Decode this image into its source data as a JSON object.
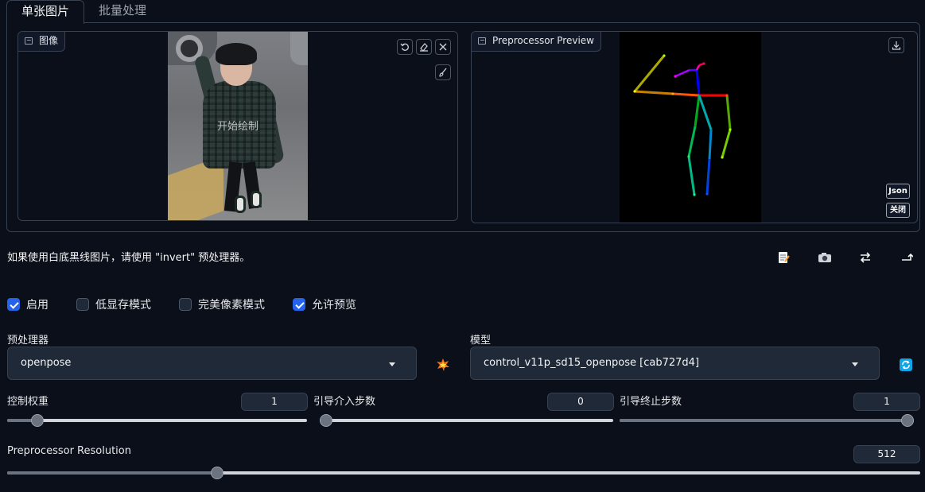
{
  "tabs": [
    {
      "label": "单张图片",
      "active": true
    },
    {
      "label": "批量处理",
      "active": false
    }
  ],
  "image_panel": {
    "label": "图像",
    "draw_hint": "开始绘制",
    "icons": [
      "undo-icon",
      "eraser-icon",
      "close-icon",
      "brush-icon"
    ]
  },
  "preview_panel": {
    "label": "Preprocessor Preview",
    "json_button": "Json",
    "close_button": "关闭",
    "icons": [
      "download-icon"
    ]
  },
  "hint": "如果使用白底黑线图片，请使用 \"invert\" 预处理器。",
  "toolbar_icons": [
    "memo-icon",
    "camera-icon",
    "swap-icon",
    "send-icon"
  ],
  "checkboxes": [
    {
      "label": "启用",
      "checked": true
    },
    {
      "label": "低显存模式",
      "checked": false
    },
    {
      "label": "完美像素模式",
      "checked": false
    },
    {
      "label": "允许预览",
      "checked": true
    }
  ],
  "preprocessor": {
    "label": "预处理器",
    "value": "openpose",
    "run_icon": "explosion-icon"
  },
  "model": {
    "label": "模型",
    "value": "control_v11p_sd15_openpose [cab727d4]",
    "refresh_icon": "refresh-icon"
  },
  "sliders": {
    "weight": {
      "label": "控制权重",
      "value": "1",
      "fraction": 0.1
    },
    "start": {
      "label": "引导介入步数",
      "value": "0",
      "fraction": 0.0
    },
    "end": {
      "label": "引导终止步数",
      "value": "1",
      "fraction": 1.0
    },
    "resolution": {
      "label": "Preprocessor Resolution",
      "value": "512",
      "fraction": 0.23
    }
  },
  "colors": {
    "background": "#0b0f19",
    "accent": "#2563eb",
    "panel_border": "#374151"
  }
}
